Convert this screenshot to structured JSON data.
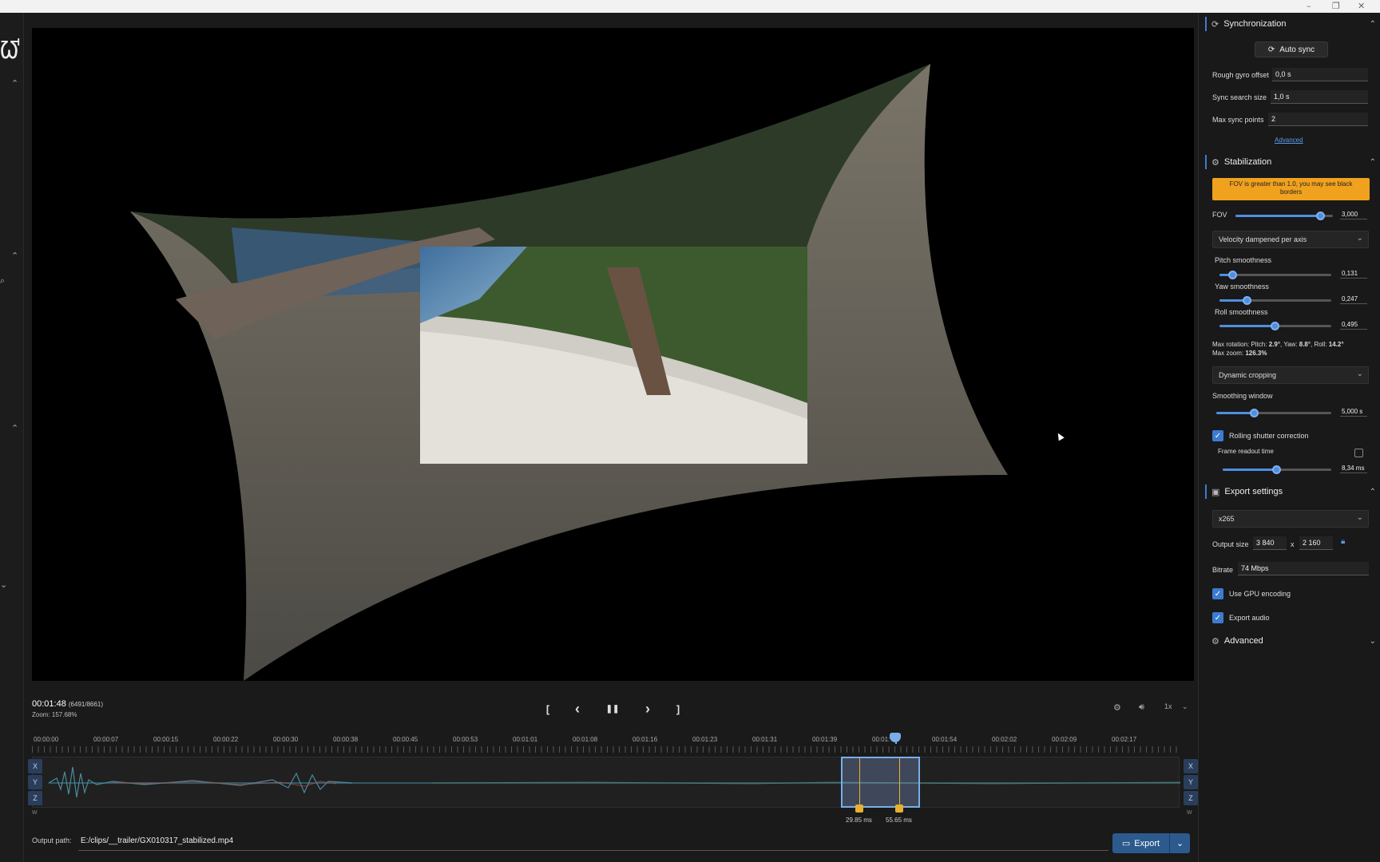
{
  "window": {
    "minimize": "–",
    "restore": "❐",
    "close": "✕"
  },
  "left_strip": {
    "logo": "ᘺ"
  },
  "player": {
    "time": "00:01:48",
    "frame": "(6491/8661)",
    "zoom": "Zoom: 157.68%",
    "speed": "1x",
    "controls": {
      "mark_in": "[",
      "prev": "‹",
      "pause": "❚❚",
      "next": "›",
      "mark_out": "]"
    }
  },
  "timeline": {
    "ruler": [
      "00:00:00",
      "00:00:07",
      "00:00:15",
      "00:00:22",
      "00:00:30",
      "00:00:38",
      "00:00:45",
      "00:00:53",
      "00:01:01",
      "00:01:08",
      "00:01:16",
      "00:01:23",
      "00:01:31",
      "00:01:39",
      "00:01:",
      "00:01:54",
      "00:02:02",
      "00:02:09",
      "00:02:17"
    ],
    "axes": [
      "X",
      "Y",
      "Z"
    ],
    "w_label": "W",
    "markers": [
      "29.85 ms",
      "55.65 ms"
    ]
  },
  "output": {
    "label": "Output path:",
    "path": "E:/clips/__trailer/GX010317_stabilized.mp4",
    "export": "Export"
  },
  "sync": {
    "title": "Synchronization",
    "auto_sync": "Auto sync",
    "rough_gyro_offset_label": "Rough gyro offset",
    "rough_gyro_offset": "0,0 s",
    "sync_search_size_label": "Sync search size",
    "sync_search_size": "1,0 s",
    "max_sync_points_label": "Max sync points",
    "max_sync_points": "2",
    "advanced_link": "Advanced"
  },
  "stabilization": {
    "title": "Stabilization",
    "warning": "FOV is greater than 1.0, you may see black borders",
    "fov_label": "FOV",
    "fov": "3,000",
    "fov_level": 0.88,
    "method": "Velocity dampened per axis",
    "pitch_label": "Pitch smoothness",
    "pitch": "0,131",
    "pitch_level": 0.12,
    "yaw_label": "Yaw smoothness",
    "yaw": "0,247",
    "yaw_level": 0.25,
    "roll_label": "Roll smoothness",
    "roll": "0,495",
    "roll_level": 0.5,
    "max_rotation_prefix": "Max rotation: Pitch: ",
    "max_pitch": "2.9°",
    "yaw_sep": ", Yaw: ",
    "max_yaw": "8.8°",
    "roll_sep": ", Roll: ",
    "max_roll": "14.2°",
    "max_zoom_prefix": "Max zoom: ",
    "max_zoom": "126.3%",
    "cropping": "Dynamic cropping",
    "window_label": "Smoothing window",
    "window": "5,000 s",
    "window_level": 0.33,
    "rolling_shutter": "Rolling shutter correction",
    "readout_label": "Frame readout time",
    "readout": "8,34 ms",
    "readout_level": 0.5
  },
  "export": {
    "title": "Export settings",
    "codec": "x265",
    "output_size_label": "Output size",
    "width": "3 840",
    "x": "x",
    "height": "2 160",
    "bitrate_label": "Bitrate",
    "bitrate": "74 Mbps",
    "gpu": "Use GPU encoding",
    "audio": "Export audio"
  },
  "advanced": {
    "title": "Advanced"
  },
  "colors": {
    "accent": "#3d7bd1",
    "warning": "#f0a21e",
    "marker": "#e8b030"
  }
}
